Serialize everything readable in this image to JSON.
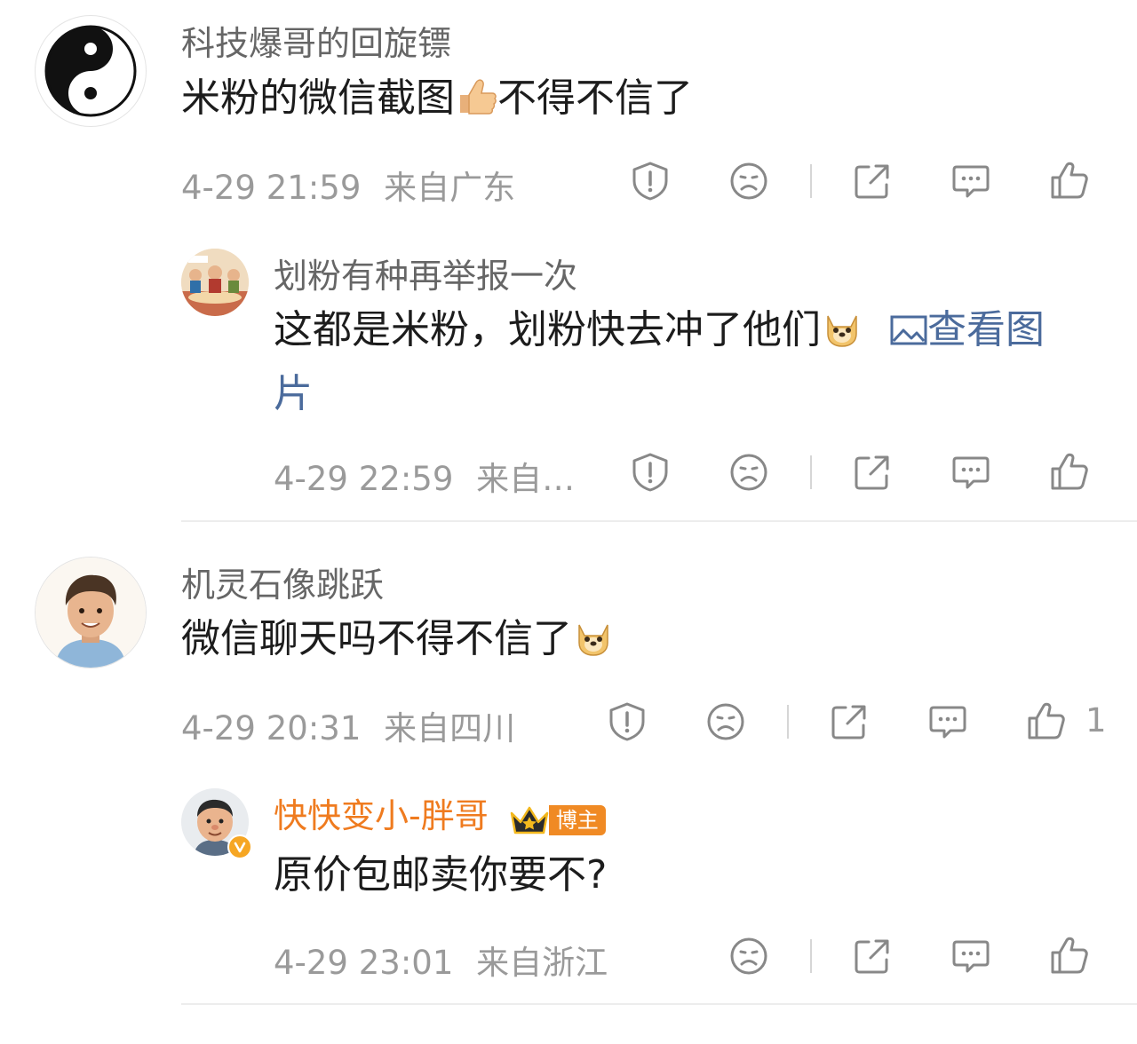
{
  "comments": [
    {
      "username": "科技爆哥的回旋镖",
      "text": "米粉的微信截图",
      "text_after_emoji": "不得不信了",
      "emoji": "thumbs-up-emoji",
      "time": "4-29 21:59",
      "location": "来自广东"
    },
    {
      "username": "划粉有种再举报一次",
      "text": "这都是米粉，划粉快去冲了他们",
      "emoji": "doge-emoji",
      "link_label": "查看图",
      "link_label_wrap": "片",
      "time": "4-29 22:59",
      "location": "来自…"
    },
    {
      "username": "机灵石像跳跃",
      "text": "微信聊天吗不得不信了",
      "emoji": "doge-emoji",
      "time": "4-29 20:31",
      "location": "来自四川",
      "like_count": "1"
    },
    {
      "username": "快快变小-胖哥",
      "badge": "博主",
      "text": "原价包邮卖你要不?",
      "time": "4-29 23:01",
      "location": "来自浙江"
    }
  ],
  "colors": {
    "owner_name": "#ef7b1f",
    "link": "#4b6b9c",
    "meta": "#9a9a9a",
    "icon": "#888888"
  }
}
